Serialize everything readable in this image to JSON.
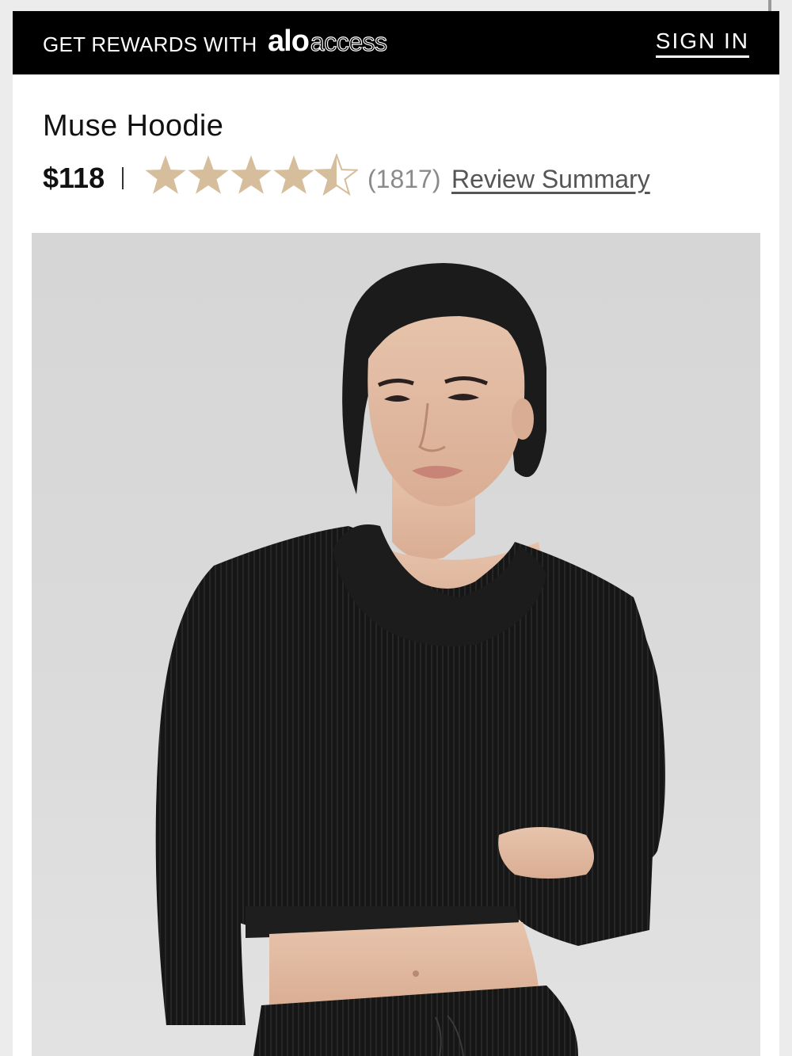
{
  "rewards_bar": {
    "text": "GET REWARDS WITH",
    "logo_alo": "alo",
    "logo_access": "access",
    "sign_in": "SIGN IN"
  },
  "product": {
    "title": "Muse Hoodie",
    "price": "$118",
    "rating": 4.5,
    "rating_max": 5,
    "review_count": "(1817)",
    "review_summary_label": "Review Summary"
  },
  "colors": {
    "bar_background": "#000000",
    "star_fill": "#d6bd9c",
    "hoodie": "#161616",
    "image_background": "#d8d8d8"
  },
  "image": {
    "alt": "Model wearing black ribbed cropped Muse Hoodie"
  }
}
